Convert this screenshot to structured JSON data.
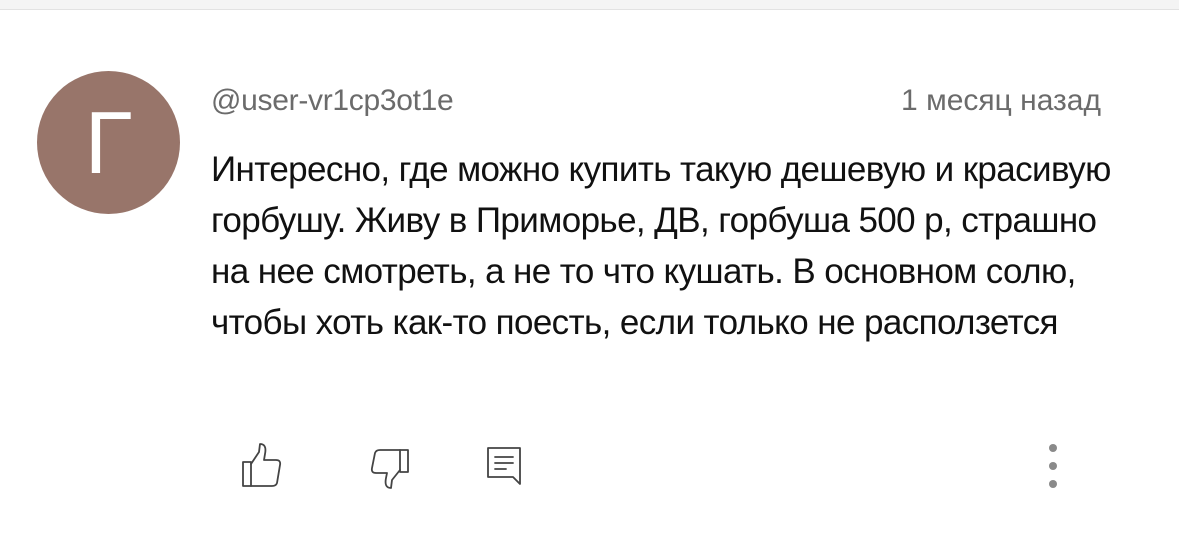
{
  "comment": {
    "avatar_letter": "Г",
    "avatar_color": "#98756a",
    "author": "@user-vr1cp3ot1e",
    "timestamp": "1 месяц назад",
    "text": "Интересно, где можно купить такую дешевую и красивую горбушу. Живу в Приморье, ДВ, горбуша 500 р, страшно на нее смотреть, а не то что кушать. В основном солю, чтобы хоть как-то поесть, если только не расползется"
  },
  "actions": {
    "like_icon": "thumbs-up-icon",
    "dislike_icon": "thumbs-down-icon",
    "reply_icon": "comment-reply-icon",
    "more_icon": "more-vertical-icon"
  }
}
